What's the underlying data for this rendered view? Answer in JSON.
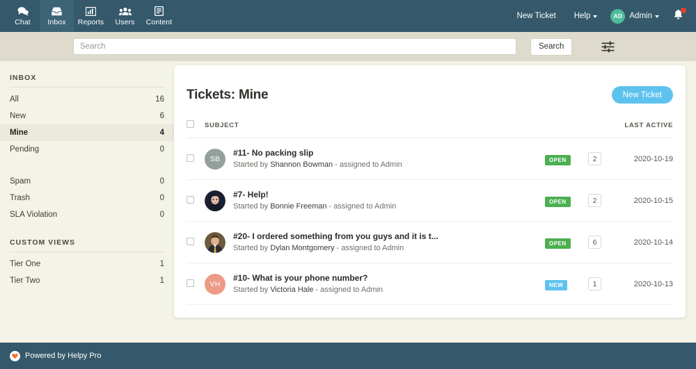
{
  "topnav": {
    "items": [
      {
        "label": "Chat",
        "icon": "chat-icon",
        "active": false
      },
      {
        "label": "Inbox",
        "icon": "inbox-icon",
        "active": true
      },
      {
        "label": "Reports",
        "icon": "reports-icon",
        "active": false
      },
      {
        "label": "Users",
        "icon": "users-icon",
        "active": false
      },
      {
        "label": "Content",
        "icon": "content-icon",
        "active": false
      }
    ],
    "new_ticket_label": "New Ticket",
    "help_label": "Help",
    "account_initials": "AD",
    "account_label": "Admin",
    "bell_icon": "notification-bell-icon",
    "has_notification": true,
    "background_color": "#35596b",
    "active_tab_color": "#3d6377",
    "avatar_color": "#4dbd9c",
    "notification_dot_color": "#e8402a"
  },
  "search": {
    "placeholder": "Search",
    "value": "",
    "button_label": "Search",
    "filter_icon": "filter-sliders-icon",
    "background_color": "#dedbcd"
  },
  "sidebar": {
    "inbox_heading": "INBOX",
    "inbox_items": [
      {
        "label": "All",
        "count": "16",
        "active": false
      },
      {
        "label": "New",
        "count": "6",
        "active": false
      },
      {
        "label": "Mine",
        "count": "4",
        "active": true
      },
      {
        "label": "Pending",
        "count": "0",
        "active": false
      }
    ],
    "system_items": [
      {
        "label": "Spam",
        "count": "0",
        "active": false
      },
      {
        "label": "Trash",
        "count": "0",
        "active": false
      },
      {
        "label": "SLA Violation",
        "count": "0",
        "active": false
      }
    ],
    "custom_heading": "CUSTOM VIEWS",
    "custom_items": [
      {
        "label": "Tier One",
        "count": "1",
        "active": false
      },
      {
        "label": "Tier Two",
        "count": "1",
        "active": false
      }
    ],
    "active_color": "#eceadb"
  },
  "main": {
    "title": "Tickets: Mine",
    "new_ticket_label": "New Ticket",
    "new_ticket_color": "#5ec2ef",
    "columns": {
      "subject": "SUBJECT",
      "last_active": "LAST ACTIVE"
    },
    "rows": [
      {
        "title": "#11- No packing slip",
        "started_by_prefix": "Started by ",
        "author": "Shannon Bowman",
        "assigned": " - assigned to Admin",
        "avatar_type": "initials",
        "avatar_initials": "SB",
        "avatar_color": "#94a09a",
        "status": "OPEN",
        "status_color": "#4caf50",
        "count": "2",
        "last_active": "2020-10-19"
      },
      {
        "title": "#7- Help!",
        "started_by_prefix": "Started by ",
        "author": "Bonnie Freeman",
        "assigned": " - assigned to Admin",
        "avatar_type": "photo",
        "avatar_initials": "BF",
        "avatar_color": "#1b2030",
        "status": "OPEN",
        "status_color": "#4caf50",
        "count": "2",
        "last_active": "2020-10-15"
      },
      {
        "title": "#20- I ordered something from you guys and it is t...",
        "started_by_prefix": "Started by ",
        "author": "Dylan Montgomery",
        "assigned": " - assigned to Admin",
        "avatar_type": "photo",
        "avatar_initials": "DM",
        "avatar_color": "#4a3a2a",
        "status": "OPEN",
        "status_color": "#4caf50",
        "count": "6",
        "last_active": "2020-10-14"
      },
      {
        "title": "#10- What is your phone number?",
        "started_by_prefix": "Started by ",
        "author": "Victoria Hale",
        "assigned": " - assigned to Admin",
        "avatar_type": "initials",
        "avatar_initials": "VH",
        "avatar_color": "#ed9a86",
        "status": "NEW",
        "status_color": "#5ec2ef",
        "count": "1",
        "last_active": "2020-10-13"
      }
    ]
  },
  "footer": {
    "text": "Powered by Helpy Pro",
    "logo_icon": "helpy-heart-logo",
    "background_color": "#35596b"
  }
}
